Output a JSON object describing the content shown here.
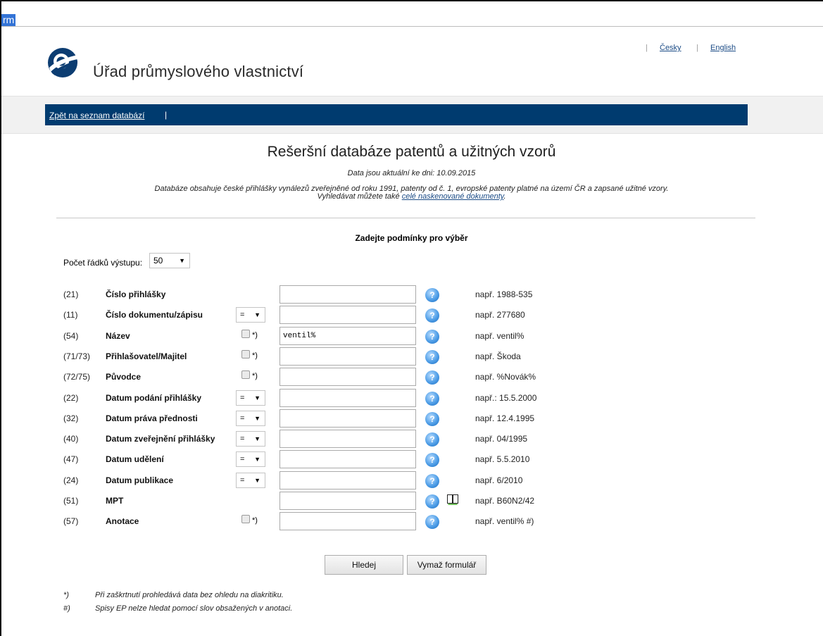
{
  "browser": {
    "selected_text": "rm"
  },
  "header": {
    "office_name": "Úřad průmyslového vlastnictví",
    "lang_links": [
      "Česky",
      "English"
    ],
    "separator": "|"
  },
  "nav": {
    "back_link": "Zpět na seznam databází",
    "separator": "|"
  },
  "page": {
    "title": "Rešeršní databáze patentů a užitných vzorů",
    "data_date": "Data jsou aktuální ke dni: 10.09.2015",
    "description_line1": "Databáze obsahuje české přihlášky vynálezů zveřejněné od roku 1991, patenty od č. 1, evropské patenty platné na území ČR a zapsané užitné vzory.",
    "description_line2_prefix": "Vyhledávat můžete také",
    "description_link": "celé naskenované dokumenty",
    "description_line2_suffix": "."
  },
  "form": {
    "title": "Zadejte podmínky pro výběr",
    "rows_label": "Počet řádků výstupu:",
    "rows_value": "50",
    "help_glyph": "?",
    "help_icon": "question-icon",
    "book_icon": "book-icon",
    "fields": [
      {
        "code": "(21)",
        "label": "Číslo přihlášky",
        "control": "none",
        "value": "",
        "example": "např. 1988-535"
      },
      {
        "code": "(11)",
        "label": "Číslo dokumentu/zápisu",
        "control": "select",
        "op": "=",
        "value": "",
        "example": "např. 277680"
      },
      {
        "code": "(54)",
        "label": "Název",
        "control": "checkbox",
        "mark": "*)",
        "value": "ventil%",
        "example": "např. ventil%"
      },
      {
        "code": "(71/73)",
        "label": "Přihlašovatel/Majitel",
        "control": "checkbox",
        "mark": "*)",
        "value": "",
        "example": "např. Škoda"
      },
      {
        "code": "(72/75)",
        "label": "Původce",
        "control": "checkbox",
        "mark": "*)",
        "value": "",
        "example": "např. %Novák%"
      },
      {
        "code": "(22)",
        "label": "Datum podání přihlášky",
        "control": "select",
        "op": "=",
        "value": "",
        "example": "např.: 15.5.2000"
      },
      {
        "code": "(32)",
        "label": "Datum práva přednosti",
        "control": "select",
        "op": "=",
        "value": "",
        "example": "např. 12.4.1995"
      },
      {
        "code": "(40)",
        "label": "Datum zveřejnění přihlášky",
        "control": "select",
        "op": "=",
        "value": "",
        "example": "např. 04/1995"
      },
      {
        "code": "(47)",
        "label": "Datum udělení",
        "control": "select",
        "op": "=",
        "value": "",
        "example": "např. 5.5.2010"
      },
      {
        "code": "(24)",
        "label": "Datum publikace",
        "control": "select",
        "op": "=",
        "value": "",
        "example": "např. 6/2010"
      },
      {
        "code": "(51)",
        "label": "MPT",
        "control": "none",
        "value": "",
        "book": true,
        "example": "např. B60N2/42"
      },
      {
        "code": "(57)",
        "label": "Anotace",
        "control": "checkbox",
        "mark": "*)",
        "value": "",
        "example": "např. ventil% #)"
      }
    ],
    "search_button": "Hledej",
    "clear_button": "Vymaž formulář"
  },
  "notes": [
    {
      "mark": "*)",
      "text": "Při zaškrtnutí prohledává data bez ohledu na diakritiku."
    },
    {
      "mark": "#)",
      "text": "Spisy EP nelze hledat pomocí slov obsažených v anotaci."
    }
  ],
  "colors": {
    "nav_bg": "#003b6f",
    "link": "#1c4c86",
    "help_icon": "#3a8ee0"
  }
}
